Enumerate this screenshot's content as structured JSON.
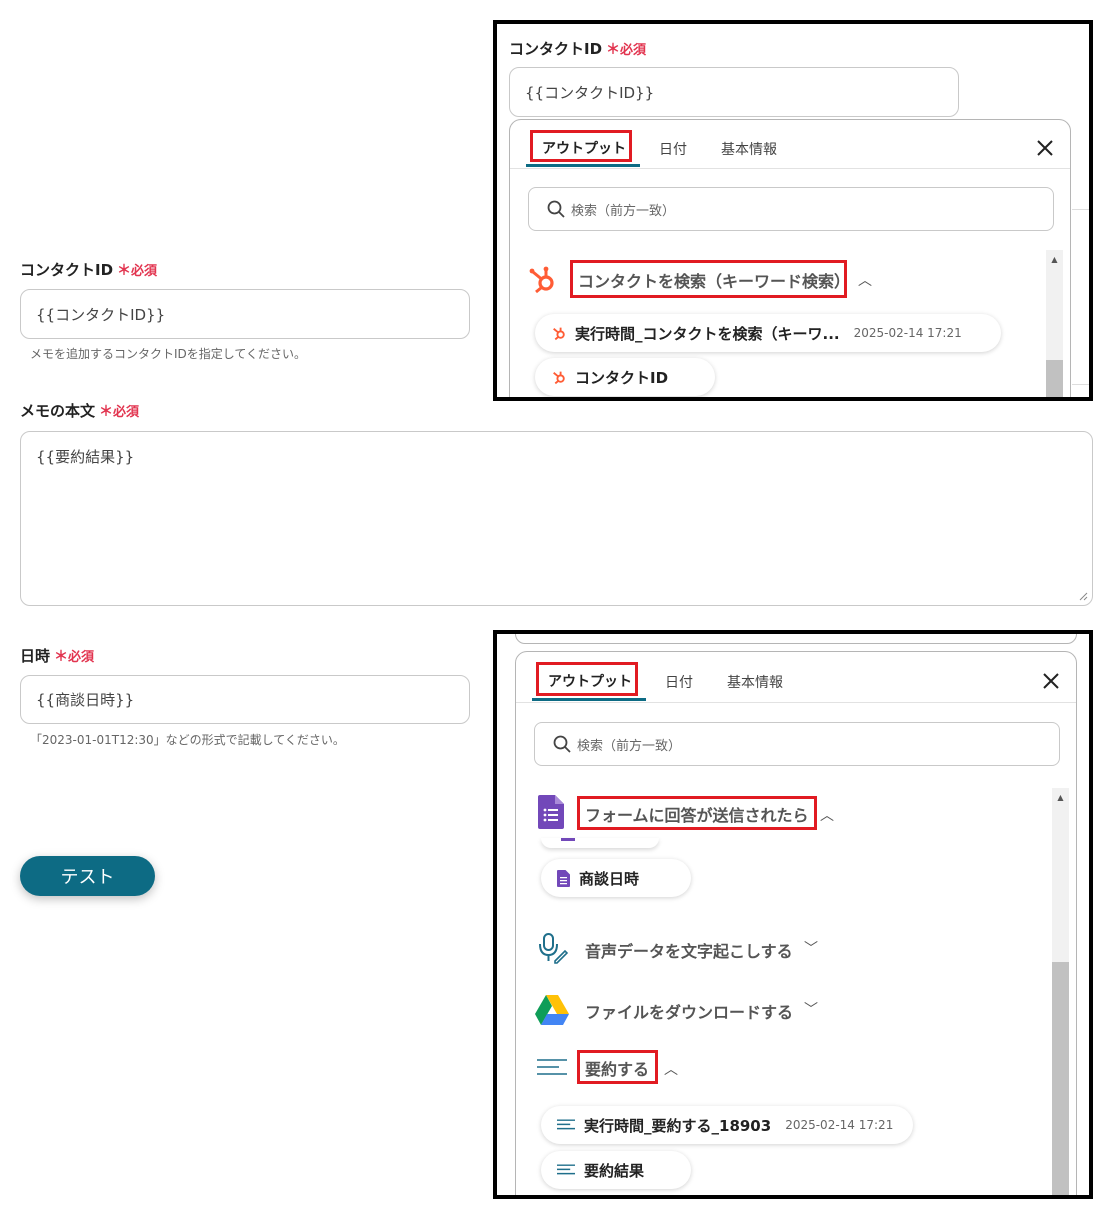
{
  "form": {
    "contact": {
      "label": "コンタクトID",
      "required": "必須",
      "value": "{{コンタクトID}}",
      "hint": "メモを追加するコンタクトIDを指定してください。"
    },
    "memo": {
      "label": "メモの本文",
      "required": "必須",
      "value": "{{要約結果}}"
    },
    "datetime": {
      "label": "日時",
      "required": "必須",
      "value": "{{商談日時}}",
      "hint": "「2023-01-01T12:30」などの形式で記載してください。"
    },
    "test_button": "テスト"
  },
  "panel_top": {
    "field_label": "コンタクトID",
    "required": "必須",
    "field_value": "{{コンタクトID}}",
    "tabs": [
      "アウトプット",
      "日付",
      "基本情報"
    ],
    "search_placeholder": "検索（前方一致）",
    "group": "コンタクトを検索（キーワード検索）",
    "items": [
      {
        "label": "実行時間_コンタクトを検索（キーワ...",
        "time": "2025-02-14 17:21"
      },
      {
        "label": "コンタクトID"
      }
    ]
  },
  "panel_bottom": {
    "tabs": [
      "アウトプット",
      "日付",
      "基本情報"
    ],
    "search_placeholder": "検索（前方一致）",
    "groups": [
      {
        "title": "フォームに回答が送信されたら"
      },
      {
        "title": "音声データを文字起こしする"
      },
      {
        "title": "ファイルをダウンロードする"
      },
      {
        "title": "要約する"
      }
    ],
    "form_item": "商談日時",
    "summary_items": [
      {
        "label": "実行時間_要約する_18903",
        "time": "2025-02-14 17:21"
      },
      {
        "label": "要約結果"
      }
    ]
  },
  "colors": {
    "accent": "#0d6b84",
    "required": "#e2344f",
    "highlight": "#e11b22",
    "hubspot": "#ff5c35"
  }
}
